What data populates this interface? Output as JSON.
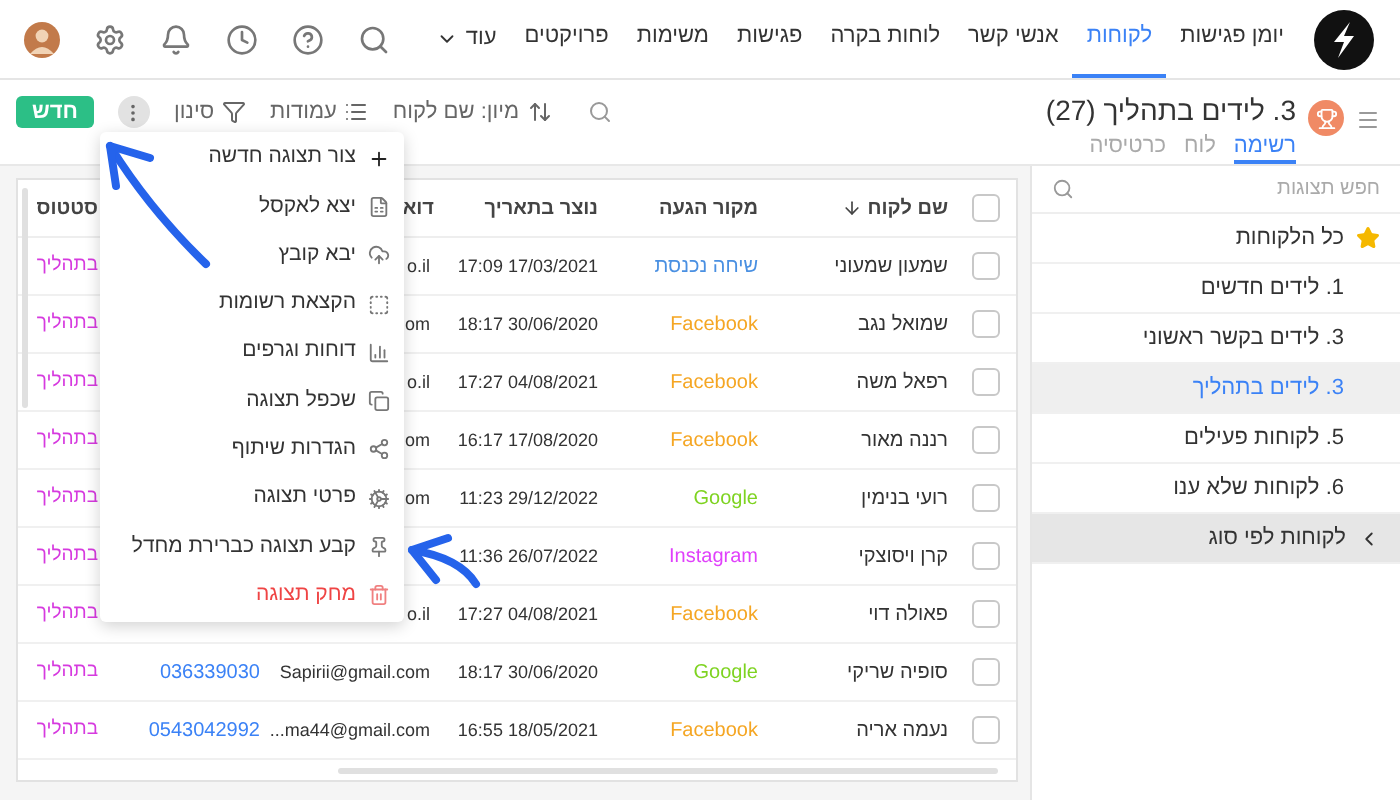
{
  "nav": {
    "items": [
      {
        "label": "יומן פגישות",
        "selected": false
      },
      {
        "label": "לקוחות",
        "selected": true
      },
      {
        "label": "אנשי קשר",
        "selected": false
      },
      {
        "label": "לוחות בקרה",
        "selected": false
      },
      {
        "label": "פגישות",
        "selected": false
      },
      {
        "label": "משימות",
        "selected": false
      },
      {
        "label": "פרויקטים",
        "selected": false
      }
    ],
    "more": "עוד"
  },
  "view": {
    "title": "3. לידים בתהליך (27)",
    "tabs": [
      {
        "label": "רשימה",
        "selected": true
      },
      {
        "label": "לוח",
        "selected": false
      },
      {
        "label": "כרטיסיה",
        "selected": false
      }
    ]
  },
  "toolbar": {
    "sort": "מיון: שם לקוח",
    "columns": "עמודות",
    "filter": "סינון",
    "new": "חדש"
  },
  "sidebar": {
    "search_placeholder": "חפש תצוגות",
    "items": [
      {
        "label": "כל הלקוחות",
        "kind": "starred",
        "selected": false
      },
      {
        "label": "1. לידים חדשים",
        "kind": "view",
        "selected": false
      },
      {
        "label": "3. לידים בקשר ראשוני",
        "kind": "view",
        "selected": false
      },
      {
        "label": "3. לידים בתהליך",
        "kind": "view",
        "selected": true
      },
      {
        "label": "5. לקוחות פעילים",
        "kind": "view",
        "selected": false
      },
      {
        "label": "6. לקוחות שלא ענו",
        "kind": "view",
        "selected": false
      },
      {
        "label": "לקוחות לפי סוג",
        "kind": "group",
        "selected": false,
        "expanded": false
      }
    ]
  },
  "table": {
    "all_checked": false,
    "columns": [
      {
        "kind": "text",
        "label": "שם לקוח",
        "sorted": true
      },
      {
        "kind": "text",
        "label": "מקור הגעה",
        "sorted": false
      },
      {
        "kind": "text",
        "label": "נוצר בתאריך",
        "sorted": false
      },
      {
        "kind": "text",
        "label": "דוא",
        "sorted": false
      },
      {
        "kind": "covered"
      },
      {
        "kind": "text",
        "label": "סטטוס",
        "sorted": false
      }
    ],
    "rows": [
      {
        "checked": false,
        "name": "שמעון שמעוני",
        "source": {
          "text": "שיחה נכנסת",
          "color": "#4a90e2"
        },
        "created": "17:09 17/03/2021",
        "email": "o.il",
        "status": "בתהליך"
      },
      {
        "checked": false,
        "name": "שמואל נגב",
        "source": {
          "text": "Facebook",
          "color": "#f5a623"
        },
        "created": "18:17 30/06/2020",
        "email": "om",
        "status": "בתהליך"
      },
      {
        "checked": false,
        "name": "רפאל משה",
        "source": {
          "text": "Facebook",
          "color": "#f5a623"
        },
        "created": "17:27 04/08/2021",
        "email": "o.il",
        "status": "בתהליך"
      },
      {
        "checked": false,
        "name": "רננה מאור",
        "source": {
          "text": "Facebook",
          "color": "#f5a623"
        },
        "created": "16:17 17/08/2020",
        "email": "om",
        "status": "בתהליך"
      },
      {
        "checked": false,
        "name": "רועי בנימין",
        "source": {
          "text": "Google",
          "color": "#7ed321"
        },
        "created": "11:23 29/12/2022",
        "email": "om",
        "status": "בתהליך"
      },
      {
        "checked": false,
        "name": "קרן ויסוצקי",
        "source": {
          "text": "Instagram",
          "color": "#e040fb"
        },
        "created": "11:36 26/07/2022",
        "status": "בתהליך"
      },
      {
        "checked": false,
        "name": "פאולה דוי",
        "source": {
          "text": "Facebook",
          "color": "#f5a623"
        },
        "created": "17:27 04/08/2021",
        "email": "o.il",
        "status": "בתהליך"
      },
      {
        "checked": false,
        "name": "סופיה שריקי",
        "source": {
          "text": "Google",
          "color": "#7ed321"
        },
        "created": "18:17 30/06/2020",
        "email": "Sapirii@gmail.com",
        "phone": "036339030",
        "status": "בתהליך"
      },
      {
        "checked": false,
        "name": "נעמה אריה",
        "source": {
          "text": "Facebook",
          "color": "#f5a623"
        },
        "created": "16:55 18/05/2021",
        "email": "...ma44@gmail.com",
        "phone": "0543042992",
        "status": "בתהליך"
      }
    ]
  },
  "view_menu": {
    "items": [
      {
        "label": "צור תצוגה חדשה",
        "kind": "normal"
      },
      {
        "label": "יצא לאקסל",
        "kind": "normal"
      },
      {
        "label": "יבא קובץ",
        "kind": "normal"
      },
      {
        "label": "הקצאת רשומות",
        "kind": "normal"
      },
      {
        "label": "דוחות וגרפים",
        "kind": "normal"
      },
      {
        "label": "שכפל תצוגה",
        "kind": "normal"
      },
      {
        "label": "הגדרות שיתוף",
        "kind": "normal"
      },
      {
        "label": "פרטי תצוגה",
        "kind": "normal"
      },
      {
        "label": "קבע תצוגה כברירת מחדל",
        "kind": "normal"
      },
      {
        "label": "מחק תצוגה",
        "kind": "danger"
      }
    ]
  }
}
